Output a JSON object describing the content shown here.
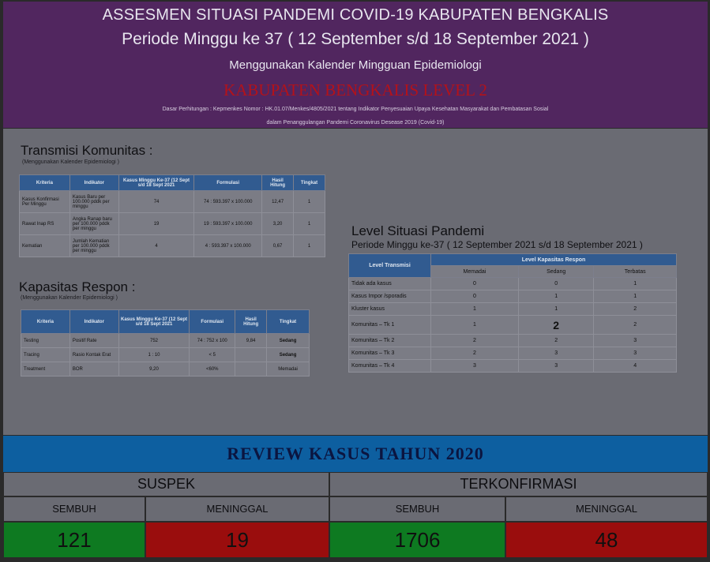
{
  "header": {
    "title": "ASSESMEN SITUASI PANDEMI COVID-19 KABUPATEN BENGKALIS",
    "period": "Periode Minggu ke 37 ( 12 September s/d 18 September 2021 )",
    "calendar": "Menggunakan Kalender Mingguan Epidemiologi",
    "level": "KABUPATEN BENGKALIS LEVEL 2",
    "basis_line1": "Dasar Perhitungan : Kepmenkes Nomor : HK.01.07/Menkes/4805/2021 tentang Indikator Penyesuaian Upaya Kesehatan Masyarakat dan Pembatasan Sosial",
    "basis_line2": "dalam Penanggulangan Pandemi Coronavirus Desease 2019 (Covid-19)"
  },
  "transmisi": {
    "title": "Transmisi Komunitas :",
    "subtitle": "(Menggunakan Kalender Epidemiologi )",
    "headers": [
      "Kriteria",
      "Indikator",
      "Kasus Minggu Ke-37 (12 Sept s/d 18 Sept 2021",
      "Formulasi",
      "Hasil Hitung",
      "Tingkat"
    ],
    "rows": [
      [
        "Kasus Konfirmasi Per Minggu",
        "Kasus Baru per 100.000 pddk per minggu",
        "74",
        "74 : 593.397 x 100.000",
        "12,47",
        "1"
      ],
      [
        "Rawat Inap RS",
        "Angka Ranap baru per 100.000 pddk per minggu",
        "19",
        "19 : 593.397 x 100.000",
        "3,20",
        "1"
      ],
      [
        "Kematian",
        "Jumlah Kematian per 100.000 pddk per minggu",
        "4",
        "4 : 593.397 x 100.000",
        "0,67",
        "1"
      ]
    ]
  },
  "kapasitas": {
    "title": "Kapasitas Respon :",
    "subtitle": "(Menggunakan Kalender Epidemiologi )",
    "headers": [
      "Kriteria",
      "Indikator",
      "Kasus Minggu Ke-37 (12 Sept s/d 18 Sept 2021",
      "Formulasi",
      "Hasil Hitung",
      "Tingkat"
    ],
    "rows": [
      [
        "Testing",
        "Positif Rate",
        "752",
        "74 : 752 x 100",
        "9,84",
        "Sedang"
      ],
      [
        "Tracing",
        "Rasio Kontak Erat",
        "1 : 10",
        "< 5",
        "",
        "Sedang"
      ],
      [
        "Treatment",
        "BOR",
        "9,20",
        "<60%",
        "",
        "Memadai"
      ]
    ]
  },
  "level_situasi": {
    "title": "Level Situasi Pandemi",
    "period": "Periode Minggu ke-37 ( 12 September 2021 s/d 18 September 2021 )",
    "col_transmisi": "Level Transmisi",
    "col_kapasitas": "Level Kapasitas Respon",
    "sub_headers": [
      "Memadai",
      "Sedang",
      "Terbatas"
    ],
    "rows": [
      [
        "Tidak ada kasus",
        "0",
        "0",
        "1"
      ],
      [
        "Kasus Impor /sporadis",
        "0",
        "1",
        "1"
      ],
      [
        "Kluster kasus",
        "1",
        "1",
        "2"
      ],
      [
        "Komunitas – Tk 1",
        "1",
        "2",
        "2"
      ],
      [
        "Komunitas – Tk 2",
        "2",
        "2",
        "3"
      ],
      [
        "Komunitas – Tk 3",
        "2",
        "3",
        "3"
      ],
      [
        "Komunitas – Tk 4",
        "3",
        "3",
        "4"
      ]
    ]
  },
  "review": {
    "title": "REVIEW KASUS TAHUN 2020",
    "suspek": {
      "label": "SUSPEK",
      "sembuh_label": "SEMBUH",
      "meninggal_label": "MENINGGAL",
      "sembuh": "121",
      "meninggal": "19"
    },
    "terkonfirmasi": {
      "label": "TERKONFIRMASI",
      "sembuh_label": "SEMBUH",
      "meninggal_label": "MENINGGAL",
      "sembuh": "1706",
      "meninggal": "48"
    }
  },
  "colors": {
    "header_bg": "#51265f",
    "level_text": "#b3121a",
    "table_header": "#315b90",
    "review_bar": "#0d5fa0",
    "green": "#0e7a21",
    "red": "#9a0d0d"
  }
}
